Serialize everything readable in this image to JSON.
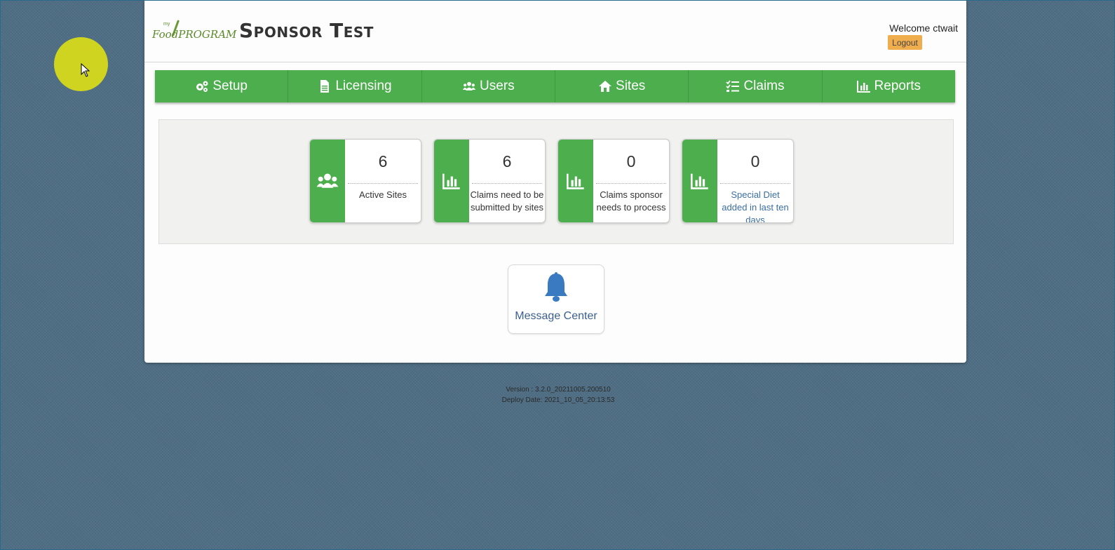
{
  "app": {
    "logo_text": "FoodPROGRAM",
    "logo_my": "my",
    "title": "Sponsor Test",
    "welcome": "Welcome ctwait",
    "logout_label": "Logout"
  },
  "nav": {
    "items": [
      {
        "label": "Setup",
        "icon": "gears-icon"
      },
      {
        "label": "Licensing",
        "icon": "document-icon"
      },
      {
        "label": "Users",
        "icon": "users-icon"
      },
      {
        "label": "Sites",
        "icon": "home-icon"
      },
      {
        "label": "Claims",
        "icon": "checklist-icon"
      },
      {
        "label": "Reports",
        "icon": "bar-chart-icon"
      }
    ]
  },
  "stats": {
    "cards": [
      {
        "value": "6",
        "label": "Active Sites",
        "icon": "users-icon"
      },
      {
        "value": "6",
        "label": "Claims need to be submitted by sites",
        "icon": "bar-chart-icon"
      },
      {
        "value": "0",
        "label": "Claims sponsor needs to process",
        "icon": "bar-chart-icon"
      },
      {
        "value": "0",
        "label": "Special Diet added in last ten days",
        "icon": "bar-chart-icon"
      }
    ]
  },
  "message_center": {
    "label": "Message Center",
    "icon": "bell-icon"
  },
  "footer": {
    "version": "Version : 3.2.0_20211005.200510",
    "deploy": "Deploy Date: 2021_10_05_20:13:53"
  },
  "colors": {
    "accent_green": "#4cae4c",
    "logout_orange": "#f0ad4e",
    "link_blue": "#3a6ea5",
    "background": "#4f6e84"
  }
}
